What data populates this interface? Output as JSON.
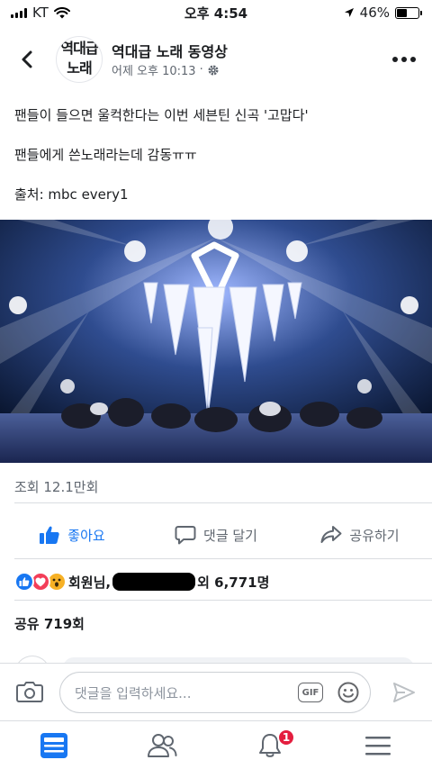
{
  "status_bar": {
    "carrier": "KT",
    "time": "오후 4:54",
    "battery_percent": "46%",
    "battery_level": 0.46
  },
  "header": {
    "avatar_text_line1": "역대급",
    "avatar_text_line2": "노래",
    "page_name": "역대급 노래 동영상",
    "timestamp": "어제 오후 10:13",
    "separator": "·"
  },
  "post": {
    "line1": "팬들이 들으면 울컥한다는 이번 세븐틴 신곡 '고맙다'",
    "line2": "팬들에게 쓴노래라는데 감동ㅠㅠ",
    "line3": "출처: mbc every1"
  },
  "stats": {
    "views": "조회 12.1만회"
  },
  "actions": {
    "like": "좋아요",
    "comment": "댓글 달기",
    "share": "공유하기"
  },
  "reactions": {
    "prefix": "회원님,",
    "suffix": "외 6,771명"
  },
  "shares": {
    "label": "공유 719회"
  },
  "comment_bar": {
    "placeholder": "댓글을 입력하세요...",
    "gif_label": "GIF"
  },
  "nav": {
    "notification_count": "1"
  },
  "colors": {
    "accent": "#1877f2",
    "like": "#1877f2",
    "love": "#f33e58",
    "wow": "#f7b125",
    "badge": "#e41e3f"
  },
  "icons": [
    "chevron-left-icon",
    "gear-icon",
    "more-icon",
    "like-icon",
    "comment-icon",
    "share-icon",
    "camera-icon",
    "emoji-icon",
    "send-icon",
    "feed-icon",
    "friends-icon",
    "bell-icon",
    "menu-icon"
  ]
}
